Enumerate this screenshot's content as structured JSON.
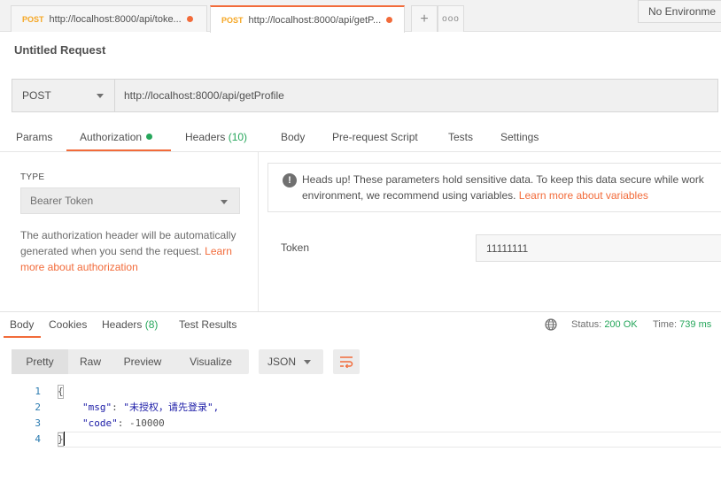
{
  "tabs": [
    {
      "method": "POST",
      "url": "http://localhost:8000/api/toke...",
      "unsaved": true
    },
    {
      "method": "POST",
      "url": "http://localhost:8000/api/getP...",
      "unsaved": true,
      "active": true
    }
  ],
  "new_tab_icon": "plus-icon",
  "more_tabs_icon": "ellipsis-icon",
  "environment": {
    "selected": "No Environme"
  },
  "request": {
    "title": "Untitled Request",
    "method": "POST",
    "url": "http://localhost:8000/api/getProfile"
  },
  "request_tabs": [
    {
      "label": "Params"
    },
    {
      "label": "Authorization",
      "active": true,
      "indicator": "green-dot"
    },
    {
      "label": "Headers",
      "count": "(10)"
    },
    {
      "label": "Body"
    },
    {
      "label": "Pre-request Script"
    },
    {
      "label": "Tests"
    },
    {
      "label": "Settings"
    }
  ],
  "auth": {
    "type_label": "TYPE",
    "type_value": "Bearer Token",
    "help_text": "The authorization header will be automatically generated when you send the request.",
    "help_link": "Learn more about authorization",
    "notice_text_1": "Heads up! These parameters hold sensitive data. To keep this data secure while work",
    "notice_text_2": "environment, we recommend using variables.",
    "notice_link": "Learn more about variables",
    "token_label": "Token",
    "token_value": "11111111"
  },
  "response_tabs": [
    {
      "label": "Body",
      "active": true
    },
    {
      "label": "Cookies"
    },
    {
      "label": "Headers",
      "count": "(8)"
    },
    {
      "label": "Test Results"
    }
  ],
  "status": {
    "status_label": "Status:",
    "status_value": "200 OK",
    "time_label": "Time:",
    "time_value": "739 ms"
  },
  "view_modes": [
    {
      "label": "Pretty",
      "active": true
    },
    {
      "label": "Raw"
    },
    {
      "label": "Preview"
    },
    {
      "label": "Visualize"
    }
  ],
  "format": "JSON",
  "code_lines": [
    {
      "n": "1",
      "text": "{"
    },
    {
      "n": "2",
      "key": "\"msg\"",
      "value": "\"未授权，请先登录\","
    },
    {
      "n": "3",
      "key": "\"code\"",
      "value": "-10000"
    },
    {
      "n": "4",
      "text": "}"
    }
  ],
  "colors": {
    "accent": "#f26b3a",
    "success": "#26a65b",
    "method_post": "#f5a623"
  }
}
